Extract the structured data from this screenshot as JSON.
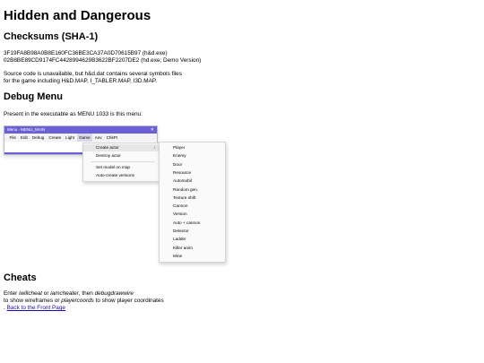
{
  "title": "Hidden and Dangerous",
  "checksums": {
    "heading": "Checksums (SHA-1)",
    "line1": "3F19FA8B98A0B8E160FC36BE3CA37A0D70615B97 (h&d.exe)",
    "line2": "02B8BE89CD9174FC4428994629B3622BF2207DE2 (hd.exe; Demo Version)"
  },
  "source_note": {
    "line1": "Source code is unavailable, but h&d.dat contains several symbols files",
    "line2": "for the game including H&D.MAP, I_TABLER.MAP, I3D.MAP."
  },
  "debug": {
    "heading": "Debug Menu",
    "intro": "Present in the executable as MENU 1033 is this menu:"
  },
  "window": {
    "title": "Menu - MENU_MAIN",
    "close": "✕",
    "menubar": [
      "File",
      "Edit",
      "Debug",
      "Create",
      "Light",
      "Game",
      "Anv",
      "ChkPt"
    ],
    "active_menu_index": 5,
    "game_menu": [
      "Create actor",
      "Destroy actor",
      "Set model on map",
      "Auto-create versions"
    ],
    "create_actor_arrow": "›",
    "actor_submenu": [
      "Player",
      "Enemy",
      "Door",
      "Resource",
      "Automobil",
      "Random gen.",
      "Texture shift",
      "Cannon",
      "Version",
      "Auto + cannon",
      "Detector",
      "Ladder",
      "Killer anim",
      "Mine"
    ]
  },
  "cheats": {
    "heading": "Cheats",
    "l1_pre": "Enter ",
    "l1_code1": "iwillcheat",
    "l1_or": " or ",
    "l1_code2": "iamcheater",
    "l1_then": ", then ",
    "l1_code3": "debugdrawwire",
    "l2_pre": "to show wireframes or ",
    "l2_code": "playercoords",
    "l2_post": " to show player coordinates",
    "link_prefix": ". ",
    "link": "Back to the Front Page"
  }
}
